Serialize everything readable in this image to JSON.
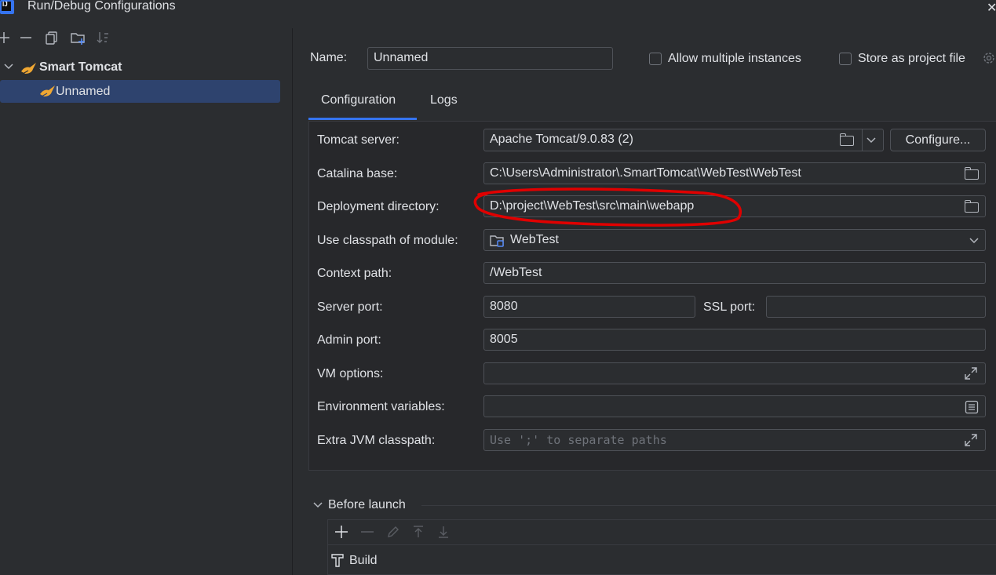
{
  "window": {
    "title": "Run/Debug Configurations",
    "app_icon_text": "IJ",
    "close_glyph": "✕"
  },
  "left_panel": {
    "toolbar": [
      {
        "name": "add-icon",
        "glyph": "+"
      },
      {
        "name": "remove-icon",
        "glyph": "—"
      },
      {
        "name": "copy-icon",
        "glyph": "⧉"
      },
      {
        "name": "new-folder-icon",
        "glyph": "▣"
      },
      {
        "name": "sort-icon",
        "glyph": "⇅"
      }
    ],
    "tree": {
      "group_label": "Smart Tomcat",
      "group_icon": "tomcat-icon",
      "items": [
        {
          "label": "Unnamed",
          "icon": "tomcat-icon",
          "selected": true
        }
      ]
    }
  },
  "header": {
    "name_label": "Name:",
    "name_value": "Unnamed",
    "allow_multiple_label": "Allow multiple instances",
    "allow_multiple_checked": false,
    "store_as_file_label": "Store as project file",
    "store_as_file_checked": false
  },
  "tabs": [
    {
      "label": "Configuration",
      "active": true
    },
    {
      "label": "Logs",
      "active": false
    }
  ],
  "config": {
    "tomcat_server_label": "Tomcat server:",
    "tomcat_server_value": "Apache Tomcat/9.0.83 (2)",
    "configure_button": "Configure...",
    "catalina_base_label": "Catalina base:",
    "catalina_base_value": "C:\\Users\\Administrator\\.SmartTomcat\\WebTest\\WebTest",
    "deployment_dir_label": "Deployment directory:",
    "deployment_dir_value": "D:\\project\\WebTest\\src\\main\\webapp",
    "classpath_module_label": "Use classpath of module:",
    "classpath_module_value": "WebTest",
    "context_path_label": "Context path:",
    "context_path_value": "/WebTest",
    "server_port_label": "Server port:",
    "server_port_value": "8080",
    "ssl_port_label": "SSL port:",
    "ssl_port_value": "",
    "admin_port_label": "Admin port:",
    "admin_port_value": "8005",
    "vm_options_label": "VM options:",
    "vm_options_value": "",
    "env_vars_label": "Environment variables:",
    "env_vars_value": "",
    "extra_jvm_label": "Extra JVM classpath:",
    "extra_jvm_placeholder": "Use ';' to separate paths"
  },
  "before_launch": {
    "label": "Before launch",
    "toolbar": [
      {
        "name": "add-task-icon",
        "glyph": "+",
        "enabled": true
      },
      {
        "name": "remove-task-icon",
        "glyph": "—",
        "enabled": false
      },
      {
        "name": "edit-task-icon",
        "glyph": "✎",
        "enabled": false
      },
      {
        "name": "move-up-icon",
        "glyph": "↑",
        "enabled": false
      },
      {
        "name": "move-down-icon",
        "glyph": "↓",
        "enabled": false
      }
    ],
    "tasks": [
      {
        "label": "Build",
        "icon": "hammer-icon"
      }
    ]
  },
  "annotation": {
    "color": "#e00000",
    "target": "deployment-directory-field"
  },
  "colors": {
    "accent": "#3574f0",
    "selection": "#2e436e",
    "background": "#2b2d30"
  }
}
